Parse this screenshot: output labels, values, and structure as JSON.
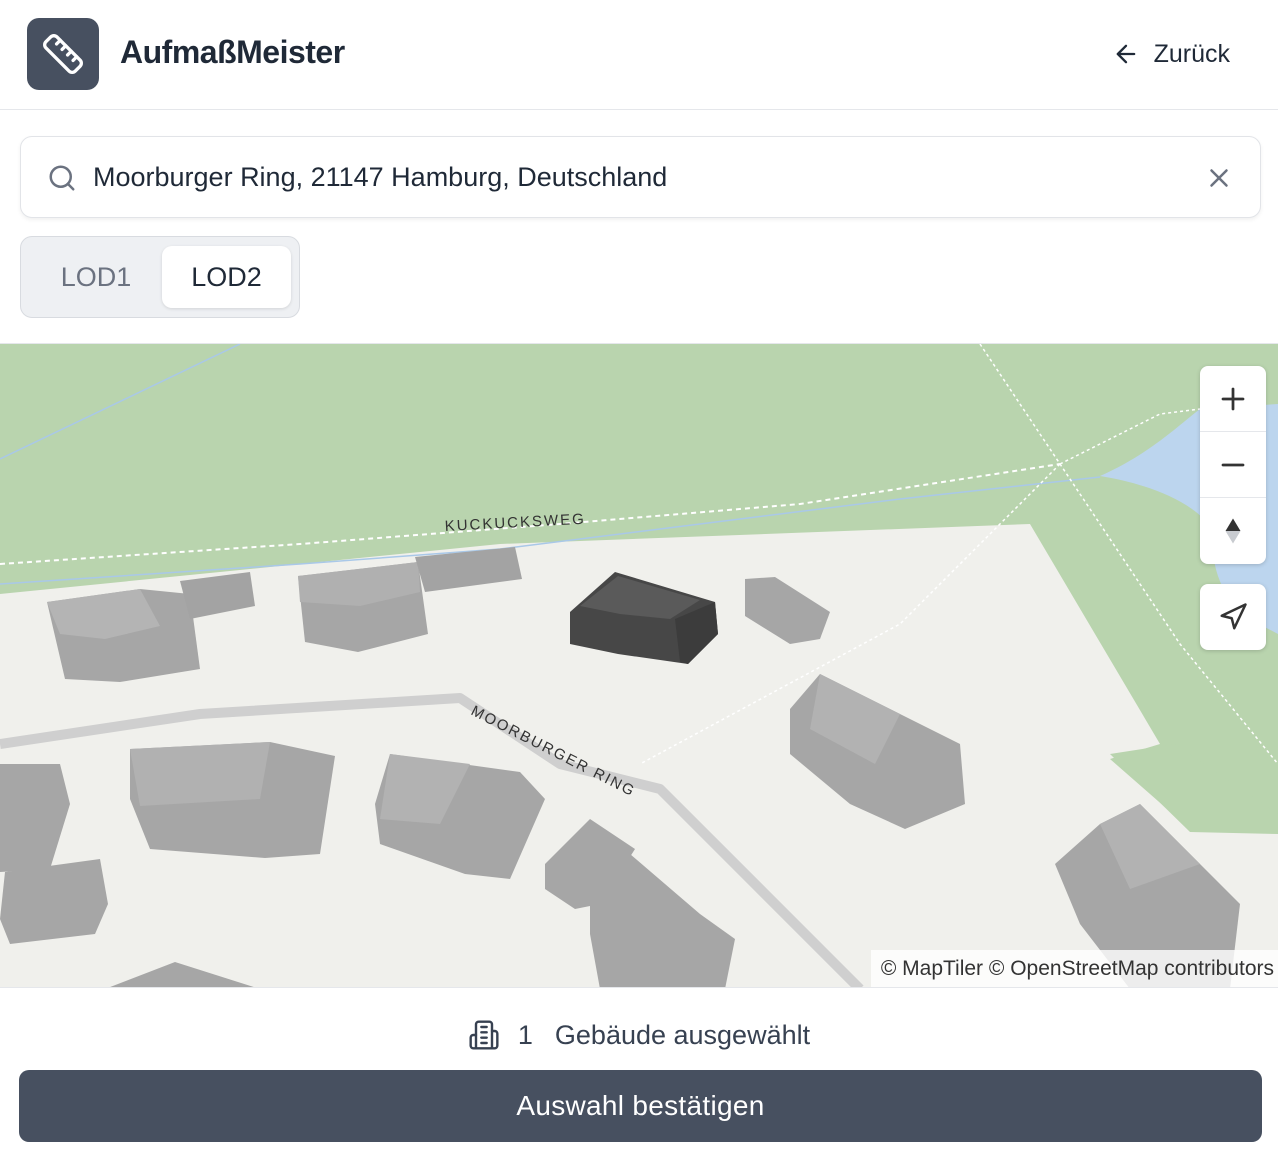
{
  "header": {
    "app_title": "AufmaßMeister",
    "logo_icon": "ruler-icon",
    "back_label": "Zurück",
    "back_icon": "arrow-left-icon"
  },
  "search": {
    "value": "Moorburger Ring, 21147 Hamburg, Deutschland",
    "icon": "search-icon",
    "clear_icon": "close-icon"
  },
  "lod_toggle": {
    "options": [
      {
        "label": "LOD1",
        "selected": false
      },
      {
        "label": "LOD2",
        "selected": true
      }
    ]
  },
  "map": {
    "road_labels": [
      "KUCKUCKSWEG",
      "MOORBURGER RING"
    ],
    "controls": {
      "zoom_in_icon": "plus-icon",
      "zoom_out_icon": "minus-icon",
      "compass_icon": "compass-icon",
      "locate_icon": "navigation-arrow-icon"
    },
    "attribution": "© MapTiler © OpenStreetMap contributors",
    "colors": {
      "park": "#b9d4ae",
      "ground": "#f0f0ec",
      "water": "#bcd5ee",
      "building": "#a6a6a6",
      "selected_building": "#474747",
      "road": "#cfcfcf"
    }
  },
  "selection": {
    "icon": "building-icon",
    "count": "1",
    "label": "Gebäude ausgewählt"
  },
  "confirm_button": {
    "label": "Auswahl bestätigen",
    "color": "#475060"
  }
}
